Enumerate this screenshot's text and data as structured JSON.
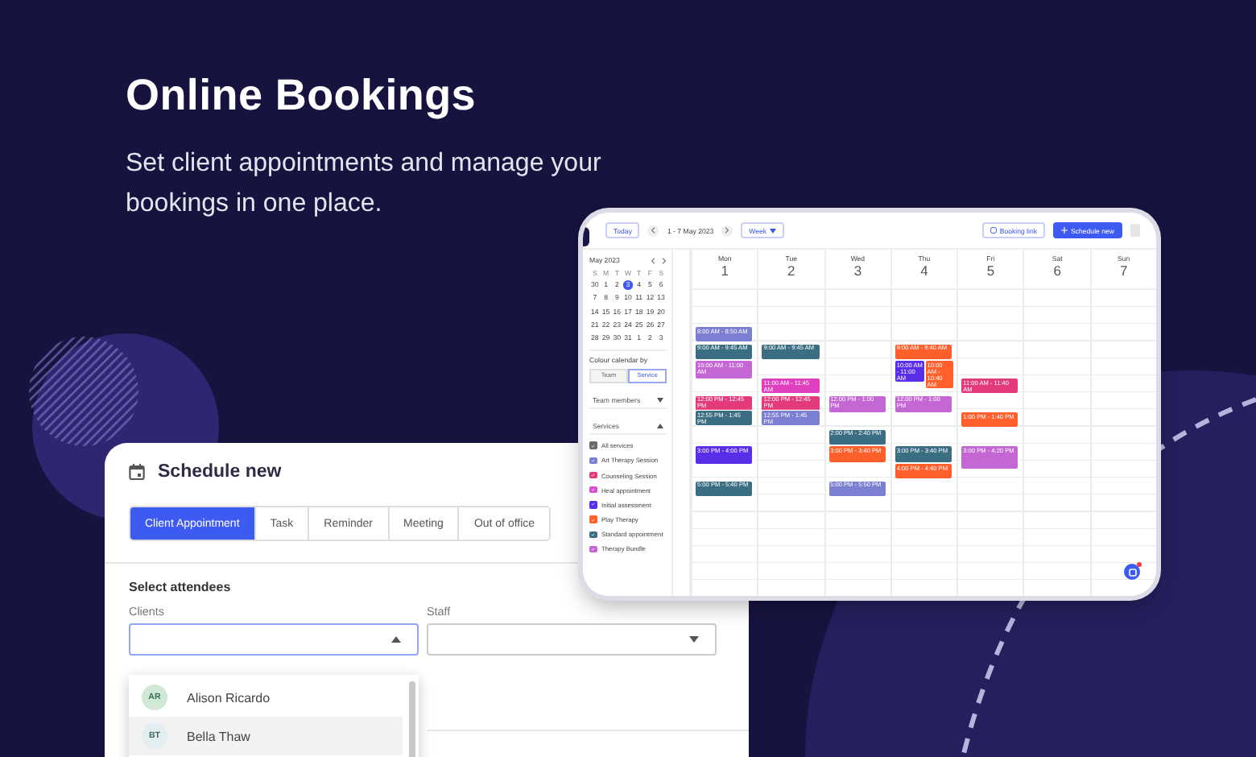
{
  "hero": {
    "title": "Online Bookings",
    "subtitle": "Set client appointments and manage your bookings in one place."
  },
  "tablet": {
    "toolbar": {
      "today": "Today",
      "range": "1 - 7 May 2023",
      "view": "Week",
      "booking_link": "Booking link",
      "schedule_button": "Schedule new"
    },
    "mini_calendar": {
      "title": "May 2023",
      "weekdays": [
        "S",
        "M",
        "T",
        "W",
        "T",
        "F",
        "S"
      ],
      "days": [
        {
          "label": "30",
          "selected": false
        },
        {
          "label": "1",
          "selected": false
        },
        {
          "label": "2",
          "selected": false
        },
        {
          "label": "3",
          "selected": true
        },
        {
          "label": "4",
          "selected": false
        },
        {
          "label": "5",
          "selected": false
        },
        {
          "label": "6",
          "selected": false
        },
        {
          "label": "7",
          "selected": false
        },
        {
          "label": "8",
          "selected": false
        },
        {
          "label": "9",
          "selected": false
        },
        {
          "label": "10",
          "selected": false
        },
        {
          "label": "11",
          "selected": false
        },
        {
          "label": "12",
          "selected": false
        },
        {
          "label": "13",
          "selected": false
        },
        {
          "label": "14",
          "selected": false
        },
        {
          "label": "15",
          "selected": false
        },
        {
          "label": "16",
          "selected": false
        },
        {
          "label": "17",
          "selected": false
        },
        {
          "label": "18",
          "selected": false
        },
        {
          "label": "19",
          "selected": false
        },
        {
          "label": "20",
          "selected": false
        },
        {
          "label": "21",
          "selected": false
        },
        {
          "label": "22",
          "selected": false
        },
        {
          "label": "23",
          "selected": false
        },
        {
          "label": "24",
          "selected": false
        },
        {
          "label": "25",
          "selected": false
        },
        {
          "label": "26",
          "selected": false
        },
        {
          "label": "27",
          "selected": false
        },
        {
          "label": "28",
          "selected": false
        },
        {
          "label": "29",
          "selected": false
        },
        {
          "label": "30",
          "selected": false
        },
        {
          "label": "31",
          "selected": false
        },
        {
          "label": "1",
          "selected": false
        },
        {
          "label": "2",
          "selected": false
        },
        {
          "label": "3",
          "selected": false
        }
      ]
    },
    "colour_by": {
      "label": "Colour calendar by",
      "options": [
        {
          "label": "Team",
          "selected": false
        },
        {
          "label": "Service",
          "selected": true
        }
      ]
    },
    "team_filter": {
      "label": "Team members"
    },
    "services": {
      "label": "Services",
      "items": [
        {
          "name": "All services",
          "color": "#6b6b6b",
          "checked": true
        },
        {
          "name": "Art Therapy Session",
          "color": "#7b7fd1",
          "checked": true
        },
        {
          "name": "Counseling Session",
          "color": "#e23a7a",
          "checked": true
        },
        {
          "name": "Heal appointment",
          "color": "#d54fcf",
          "checked": true
        },
        {
          "name": "Initial assessment",
          "color": "#5a2ee8",
          "checked": true
        },
        {
          "name": "Play Therapy",
          "color": "#ff5f2a",
          "checked": true
        },
        {
          "name": "Standard appointment",
          "color": "#3b6e83",
          "checked": true
        },
        {
          "name": "Therapy Bundle",
          "color": "#c466d4",
          "checked": true
        }
      ]
    },
    "days": [
      {
        "weekday": "Mon",
        "date": "1",
        "events": [
          {
            "color": "#7b7fd1",
            "time": "8:00 AM - 8:50 AM"
          },
          {
            "color": "#3b6e83",
            "time": "9:00 AM - 9:45 AM"
          },
          {
            "color": "#c466d4",
            "time": "10:00 AM - 11:00 AM"
          },
          {
            "color": "#e23a7a",
            "time": "12:00 PM - 12:45 PM"
          },
          {
            "color": "#3b6e83",
            "time": "12:55 PM - 1:45 PM"
          },
          {
            "color": "#5a2ee8",
            "time": "3:00 PM - 4:00 PM"
          },
          {
            "color": "#3b6e83",
            "time": "5:00 PM - 5:40 PM"
          }
        ]
      },
      {
        "weekday": "Tue",
        "date": "2",
        "events": [
          {
            "color": "#3b6e83",
            "time": "9:00 AM - 9:45 AM"
          },
          {
            "color": "#e040c0",
            "time": "11:00 AM - 11:45 AM"
          },
          {
            "color": "#e23a7a",
            "time": "12:00 PM - 12:45 PM"
          },
          {
            "color": "#7b7fd1",
            "time": "12:55 PM - 1:45 PM"
          }
        ]
      },
      {
        "weekday": "Wed",
        "date": "3",
        "events": [
          {
            "color": "#c466d4",
            "time": "12:00 PM - 1:00 PM"
          },
          {
            "color": "#3b6e83",
            "time": "2:00 PM - 2:40 PM"
          },
          {
            "color": "#ff5f2a",
            "time": "3:00 PM - 3:40 PM"
          },
          {
            "color": "#7b7fd1",
            "time": "5:00 PM - 5:50 PM"
          }
        ]
      },
      {
        "weekday": "Thu",
        "date": "4",
        "events": [
          {
            "color": "#ff5f2a",
            "time": "9:00 AM - 9:40 AM"
          },
          {
            "color": "#5a2ee8",
            "time": "10:00 AM - 11:00 AM",
            "overlap": false
          },
          {
            "color": "#ff5f2a",
            "time": "10:00 AM - 10:40 AM",
            "overlap": true
          },
          {
            "color": "#c466d4",
            "time": "12:00 PM - 1:00 PM"
          },
          {
            "color": "#3b6e83",
            "time": "3:00 PM - 3:40 PM"
          },
          {
            "color": "#ff5f2a",
            "time": "4:00 PM - 4:40 PM"
          }
        ]
      },
      {
        "weekday": "Fri",
        "date": "5",
        "events": [
          {
            "color": "#e23a7a",
            "time": "11:00 AM - 11:40 AM"
          },
          {
            "color": "#ff5f2a",
            "time": "1:00 PM - 1:40 PM"
          },
          {
            "color": "#c466d4",
            "time": "3:00 PM - 4:20 PM"
          }
        ]
      },
      {
        "weekday": "Sat",
        "date": "6"
      },
      {
        "weekday": "Sun",
        "date": "7"
      }
    ]
  },
  "schedule": {
    "title": "Schedule new",
    "tabs": [
      {
        "label": "Client Appointment",
        "selected": true
      },
      {
        "label": "Task",
        "selected": false
      },
      {
        "label": "Reminder",
        "selected": false
      },
      {
        "label": "Meeting",
        "selected": false
      },
      {
        "label": "Out of office",
        "selected": false
      }
    ],
    "section": "Select attendees",
    "clients": {
      "label": "Clients",
      "expanded": true,
      "options": [
        {
          "initials": "AR",
          "name": "Alison Ricardo",
          "color": "#cfe9d5",
          "highlighted": false
        },
        {
          "initials": "BT",
          "name": "Bella Thaw",
          "color": "#e2eef2",
          "highlighted": true
        }
      ]
    },
    "staff": {
      "label": "Staff",
      "expanded": false
    }
  }
}
